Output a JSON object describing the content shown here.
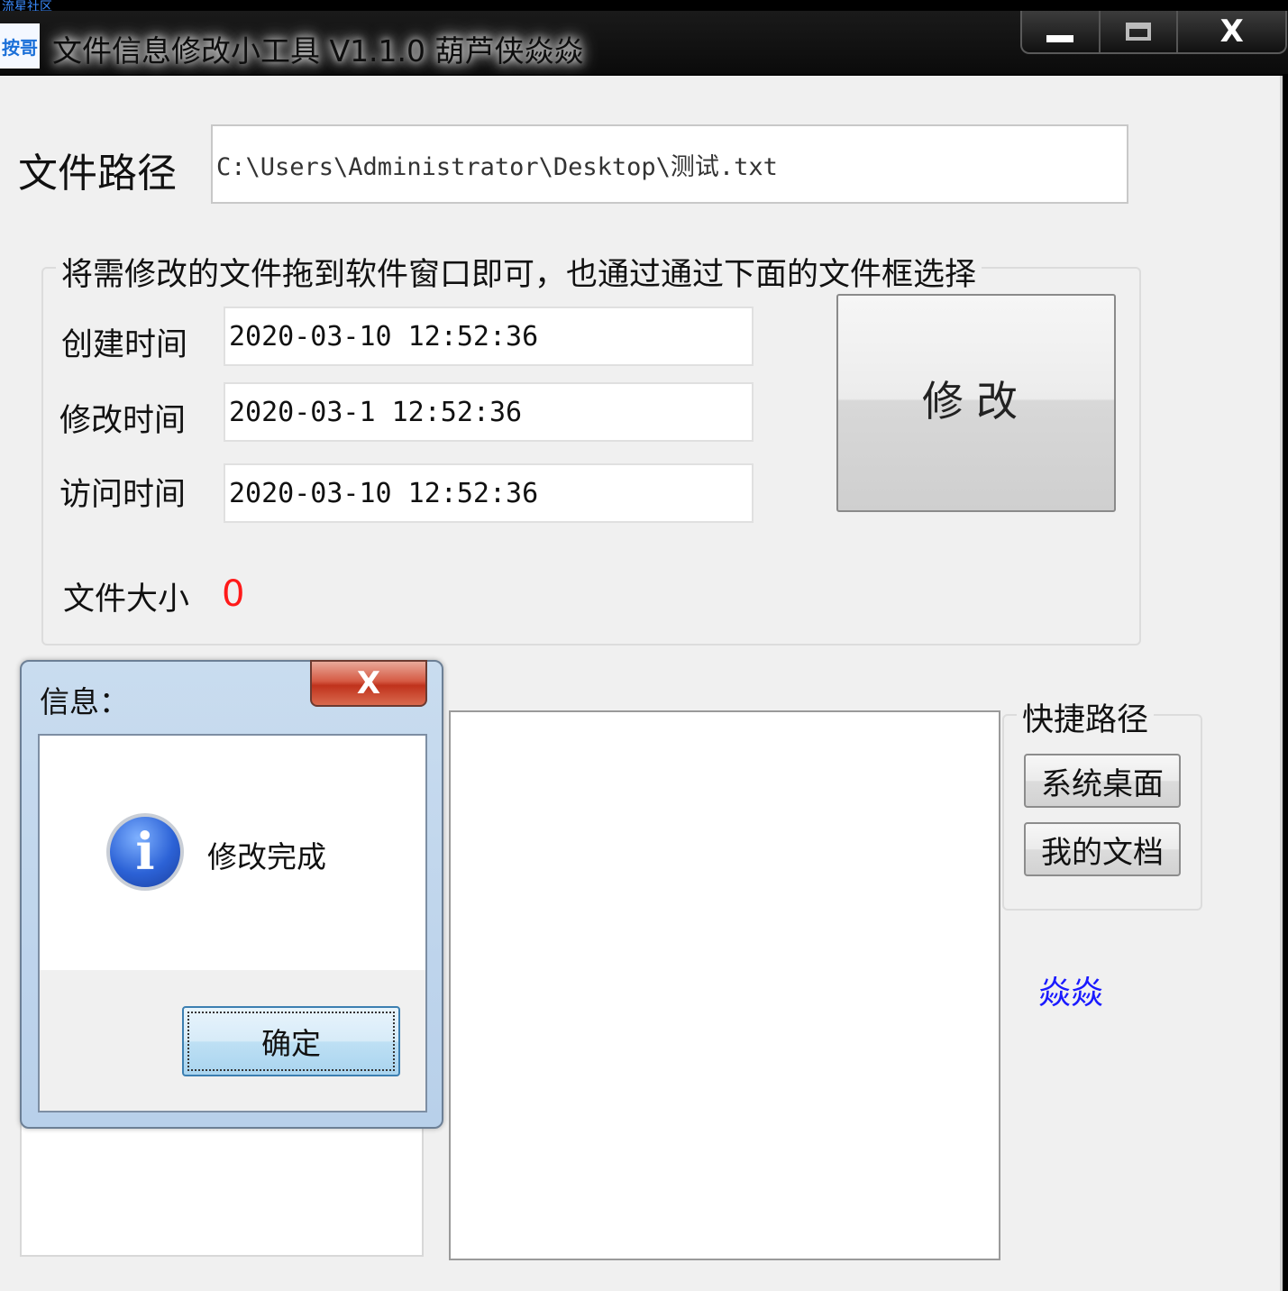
{
  "watermark": "流星社区",
  "window": {
    "icon_text": "按哥",
    "title": "文件信息修改小工具 V1.1.0 葫芦侠焱焱",
    "close_glyph": "X"
  },
  "file_path": {
    "label": "文件路径",
    "value": "C:\\Users\\Administrator\\Desktop\\测试.txt"
  },
  "group": {
    "title": "将需修改的文件拖到软件窗口即可，也通过通过下面的文件框选择",
    "created_label": "创建时间",
    "created_value": "2020-03-10 12:52:36",
    "modified_label": "修改时间",
    "modified_value": "2020-03-1 12:52:36",
    "accessed_label": "访问时间",
    "accessed_value": "2020-03-10 12:52:36",
    "modify_button": "修改",
    "size_label": "文件大小",
    "size_value": "0"
  },
  "quick": {
    "title": "快捷路径",
    "desktop_button": "系统桌面",
    "documents_button": "我的文档"
  },
  "author_link": "焱焱",
  "dialog": {
    "title": "信息：",
    "close_glyph": "X",
    "message": "修改完成",
    "ok_button": "确定"
  },
  "colors": {
    "size_value": "#ff1a1a",
    "author_link": "#1a1aff"
  }
}
